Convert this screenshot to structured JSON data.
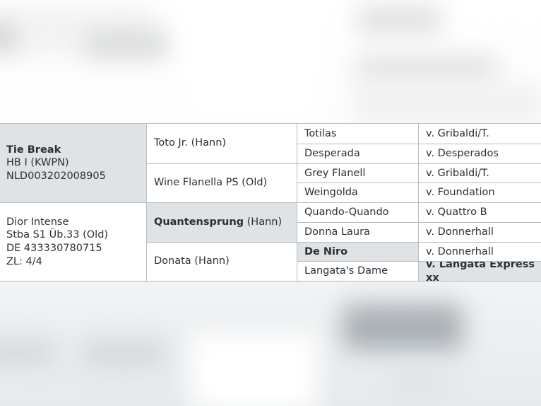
{
  "document": {
    "type": "horse-pedigree-table",
    "colors": {
      "cell_border": "#b9bcc0",
      "shaded_cell": "#dfe3e6",
      "text": "#2d3033",
      "page_background": "#ffffff"
    }
  },
  "pedigree": {
    "subject_blocks": [
      {
        "name": "Tie Break",
        "name_bold": true,
        "lines": [
          "HB I (KWPN)",
          "NLD003202008905"
        ],
        "shaded": true
      },
      {
        "name": " Dior Intense",
        "name_bold": false,
        "lines": [
          "Stba S1 Üb.33 (Old)",
          "DE 433330780715",
          "ZL: 4/4"
        ],
        "shaded": false
      }
    ],
    "generation_2": [
      {
        "name": "Toto Jr.",
        "suffix": "(Hann)",
        "bold": false,
        "shaded": false
      },
      {
        "name": "Wine Flanella PS",
        "suffix": "(Old)",
        "bold": false,
        "shaded": false
      },
      {
        "name": "Quantensprung",
        "suffix": "(Hann)",
        "bold": true,
        "shaded": true
      },
      {
        "name": "Donata",
        "suffix": "(Hann)",
        "bold": false,
        "shaded": false
      }
    ],
    "generation_3": [
      {
        "name": "Totilas",
        "bold": false,
        "shaded": false
      },
      {
        "name": "Desperada",
        "bold": false,
        "shaded": false
      },
      {
        "name": "Grey Flanell",
        "bold": false,
        "shaded": false
      },
      {
        "name": "Weingolda",
        "bold": false,
        "shaded": false
      },
      {
        "name": "Quando-Quando",
        "bold": false,
        "shaded": false
      },
      {
        "name": "Donna Laura",
        "bold": false,
        "shaded": false
      },
      {
        "name": "De Niro",
        "bold": true,
        "shaded": true
      },
      {
        "name": "Langata's Dame",
        "bold": false,
        "shaded": false
      }
    ],
    "generation_4": [
      {
        "name": "v. Gribaldi/T.",
        "bold": false,
        "shaded": false
      },
      {
        "name": "v. Desperados",
        "bold": false,
        "shaded": false
      },
      {
        "name": "v. Gribaldi/T.",
        "bold": false,
        "shaded": false
      },
      {
        "name": "v. Foundation",
        "bold": false,
        "shaded": false
      },
      {
        "name": "v. Quattro B",
        "bold": false,
        "shaded": false
      },
      {
        "name": "v. Donnerhall",
        "bold": false,
        "shaded": false
      },
      {
        "name": "v. Donnerhall",
        "bold": false,
        "shaded": false
      },
      {
        "name": "v. Langata Express xx",
        "bold": true,
        "shaded": true
      }
    ]
  }
}
